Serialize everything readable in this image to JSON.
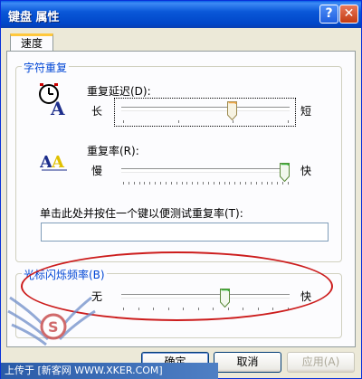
{
  "window": {
    "title": "键盘 属性",
    "help_button": "?",
    "close_button": "✕"
  },
  "tabs": [
    {
      "label": "速度",
      "selected": true
    }
  ],
  "character_repeat": {
    "group_label": "字符重复",
    "delay": {
      "label": "重复延迟(D):",
      "left_label": "长",
      "right_label": "短",
      "value_fraction": 0.67
    },
    "rate": {
      "label": "重复率(R):",
      "left_label": "慢",
      "right_label": "快",
      "value_fraction": 1.0
    },
    "test_label": "单击此处并按住一个键以便测试重复率(T):",
    "test_value": ""
  },
  "cursor_blink": {
    "group_label": "光标闪烁频率(B)",
    "left_label": "无",
    "right_label": "快",
    "value_fraction": 0.62
  },
  "buttons": {
    "ok": "确定",
    "cancel": "取消",
    "apply": "应用(A)"
  },
  "footer_text": "上传于 [新客网 WWW.XKER.COM]",
  "colors": {
    "titlebar": "#0a58d8",
    "group_label": "#0046d5",
    "annotation_ellipse": "#cc1c1c"
  }
}
